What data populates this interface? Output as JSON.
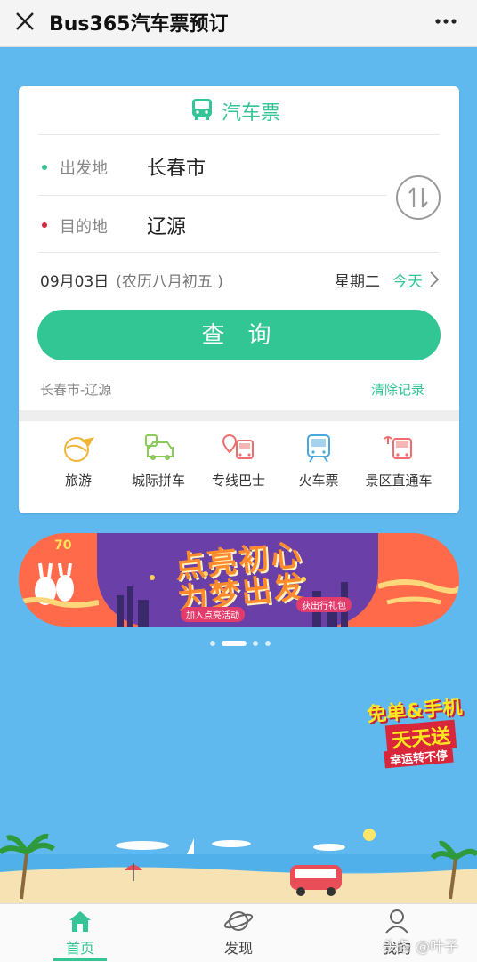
{
  "window": {
    "title": "Bus365汽车票预订"
  },
  "card": {
    "title": "汽车票",
    "from_label": "出发地",
    "from_value": "长春市",
    "to_label": "目的地",
    "to_value": "辽源",
    "date": "09月03日",
    "lunar": "(农历八月初五 )",
    "weekday": "星期二",
    "today_label": "今天",
    "query_label": "查询",
    "history": "长春市-辽源",
    "clear_label": "清除记录"
  },
  "categories": [
    {
      "label": "旅游",
      "icon": "airplane-globe-icon"
    },
    {
      "label": "城际拼车",
      "icon": "car-icon"
    },
    {
      "label": "专线巴士",
      "icon": "bus-pin-icon"
    },
    {
      "label": "火车票",
      "icon": "train-icon"
    },
    {
      "label": "景区直通车",
      "icon": "scenic-bus-icon"
    }
  ],
  "banner": {
    "line1": "点亮初心",
    "line2": "为梦出发",
    "tag1": "加入点亮活动",
    "tag2": "获出行礼包",
    "badge": "70"
  },
  "carousel": {
    "count": 4,
    "active_index": 1
  },
  "promo": {
    "line1": "免单&手机",
    "line2": "天天送",
    "line3": "幸运转不停"
  },
  "bottom_nav": [
    {
      "label": "首页",
      "icon": "home-icon",
      "active": true
    },
    {
      "label": "发现",
      "icon": "planet-icon",
      "active": false
    },
    {
      "label": "我的",
      "icon": "user-icon",
      "active": false
    }
  ],
  "watermark": "头条 @叶子",
  "colors": {
    "accent": "#35c496",
    "background": "#5fb9ee",
    "from_dot": "#35c496",
    "to_dot": "#d8273b"
  }
}
